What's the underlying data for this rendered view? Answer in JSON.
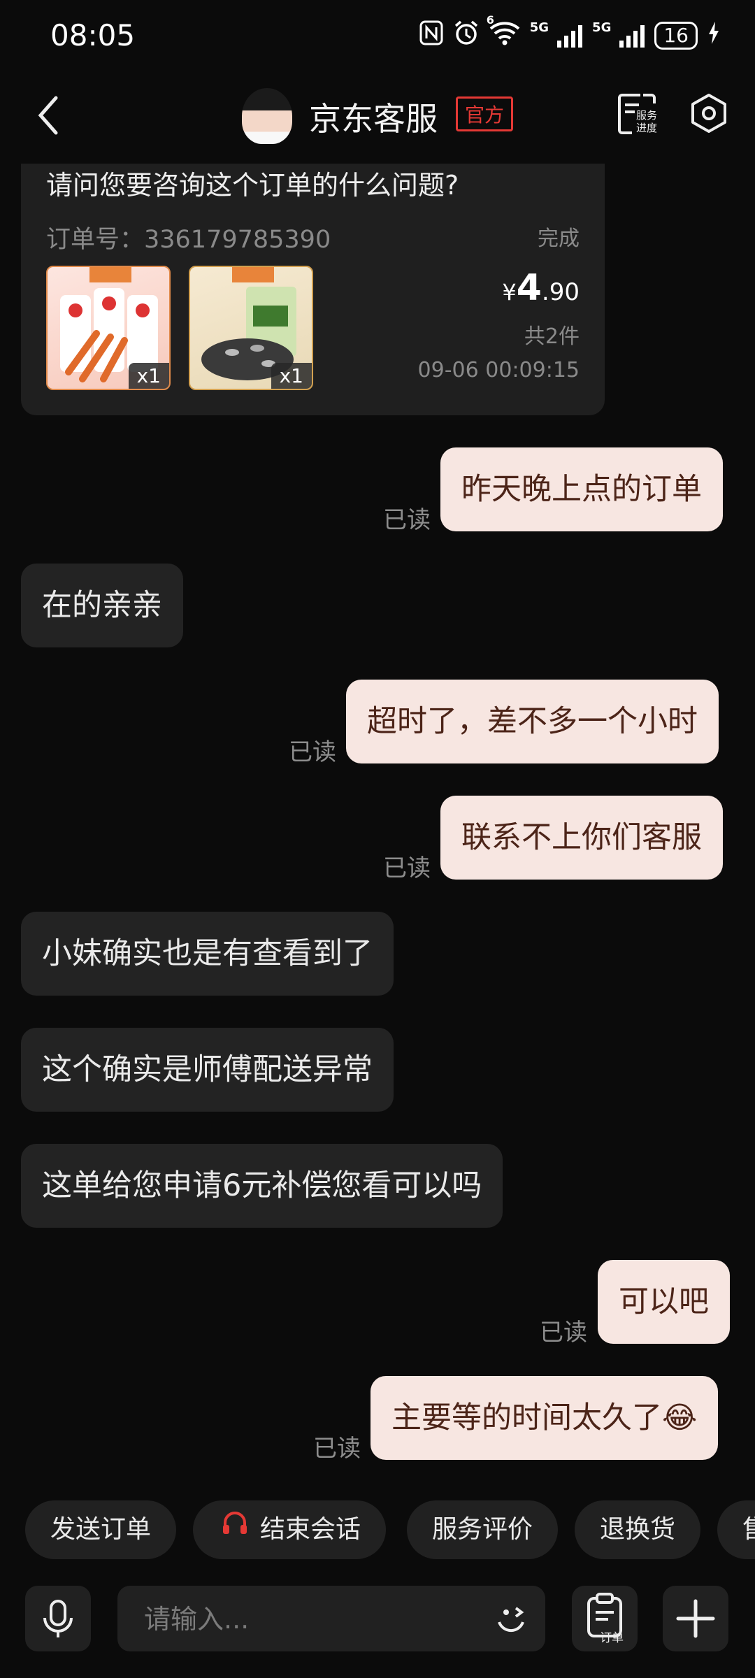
{
  "status_bar": {
    "time": "08:05",
    "network_5g_a": "5G",
    "network_5g_b": "5G",
    "wifi_badge": "6",
    "battery": "16"
  },
  "header": {
    "title": "京东客服",
    "badge": "官方",
    "progress_icon_label_1": "服务",
    "progress_icon_label_2": "进度"
  },
  "order": {
    "question": "请问您要咨询这个订单的什么问题?",
    "order_no": "订单号：336179785390",
    "status": "完成",
    "items": [
      {
        "qty": "x1"
      },
      {
        "qty": "x1"
      }
    ],
    "price_currency": "¥",
    "price_int": "4",
    "price_dec": ".90",
    "count": "共2件",
    "time": "09-06 00:09:15"
  },
  "messages": [
    {
      "dir": "out",
      "text": "昨天晚上点的订单",
      "read": "已读"
    },
    {
      "dir": "in",
      "text": "在的亲亲"
    },
    {
      "dir": "out",
      "text": "超时了，差不多一个小时",
      "read": "已读"
    },
    {
      "dir": "out",
      "text": "联系不上你们客服",
      "read": "已读"
    },
    {
      "dir": "in",
      "text": "小妹确实也是有查看到了"
    },
    {
      "dir": "in",
      "text": "这个确实是师傅配送异常"
    },
    {
      "dir": "in",
      "text": "这单给您申请6元补偿您看可以吗"
    },
    {
      "dir": "out",
      "text": "可以吧",
      "read": "已读"
    },
    {
      "dir": "out",
      "text": "主要等的时间太久了😂",
      "read": "已读"
    }
  ],
  "quick_actions": [
    "发送订单",
    "结束会话",
    "服务评价",
    "退换货",
    "售"
  ],
  "input": {
    "placeholder": "请输入...",
    "order_button_label": "订单"
  },
  "colors": {
    "outgoing_bubble": "#f7e6e1",
    "incoming_bubble": "#232323",
    "official_badge": "#e53935",
    "headset_icon": "#e53935"
  }
}
